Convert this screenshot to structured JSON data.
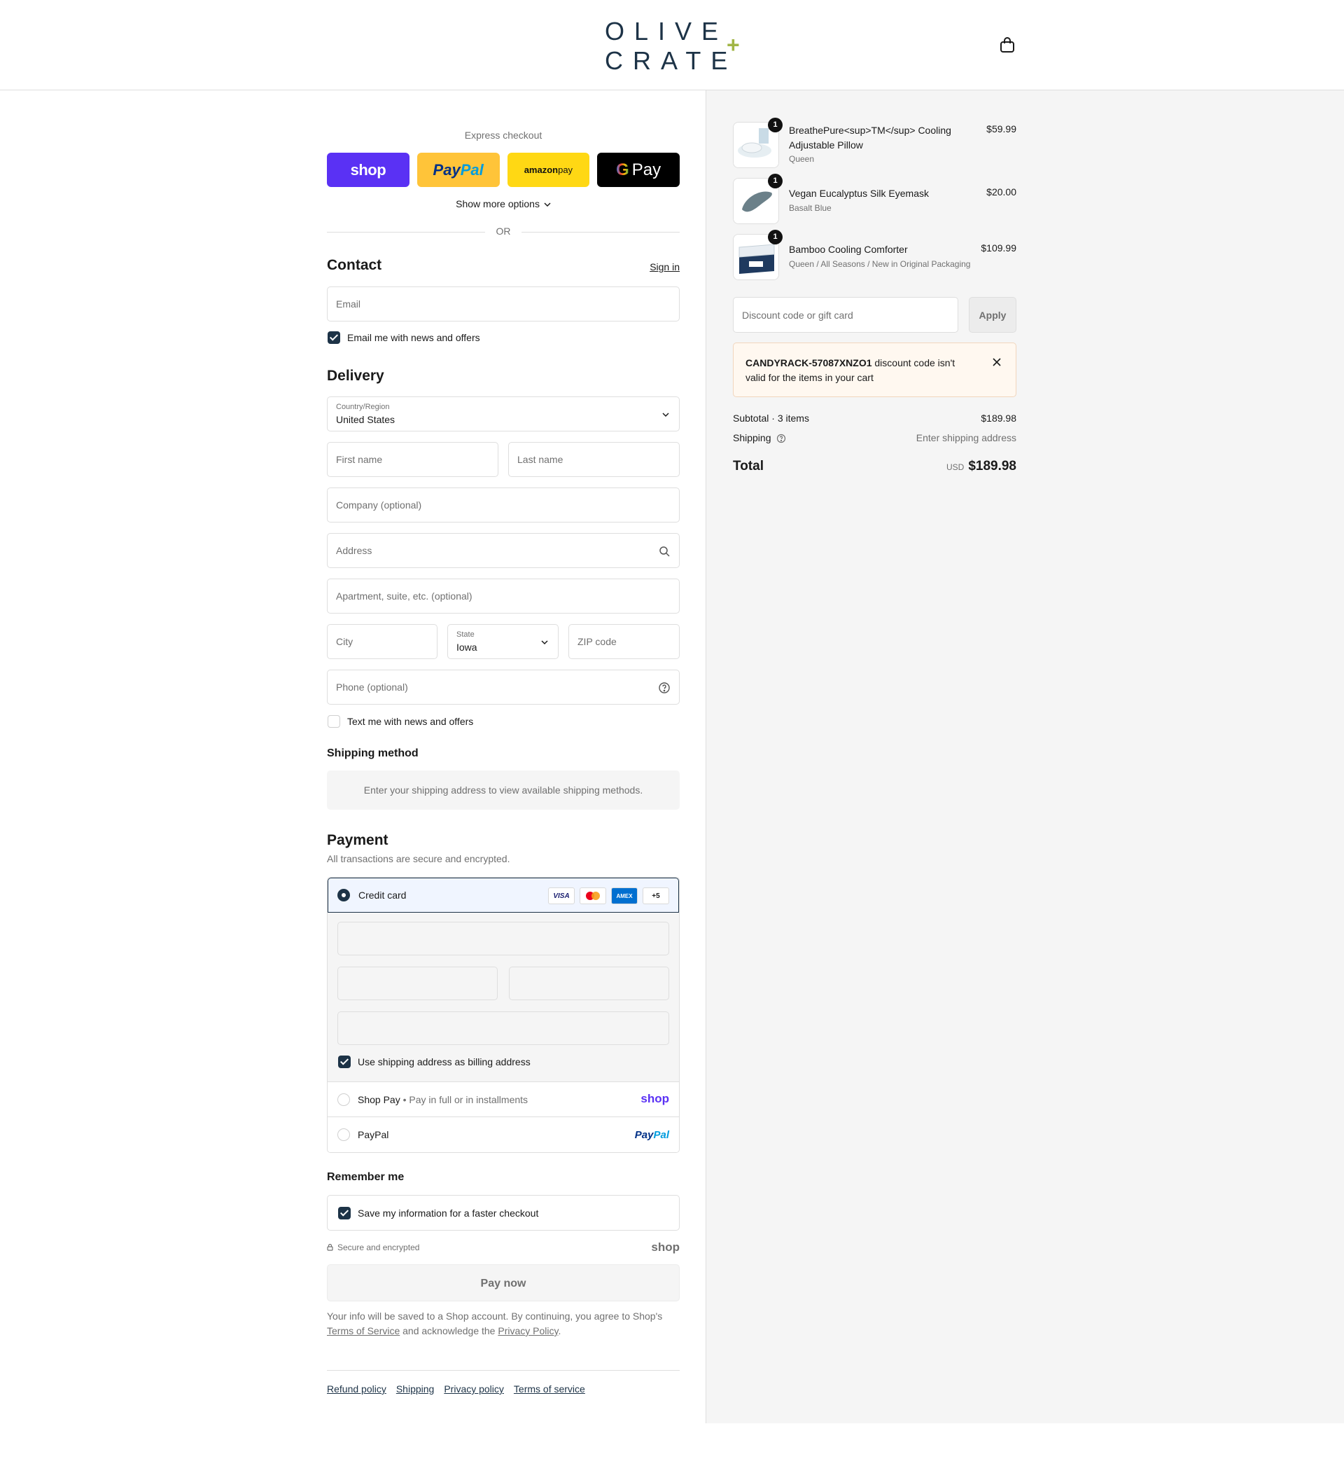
{
  "brand": {
    "line1": "OLIVE",
    "line2": "CRATE",
    "mark": "+",
    "accent": "#a1b545",
    "navy": "#1d3347"
  },
  "header": {
    "cart_icon": "shopping-bag-icon"
  },
  "express": {
    "title": "Express checkout",
    "shop_label": "shop",
    "paypal_label_a": "Pay",
    "paypal_label_b": "Pal",
    "amazon_label_a": "amazon",
    "amazon_label_b": " pay",
    "gpay_g": "G",
    "gpay_label": "Pay",
    "more_options": "Show more options",
    "or": "OR"
  },
  "contact": {
    "title": "Contact",
    "sign_in": "Sign in",
    "email_placeholder": "Email",
    "email_opt_in": "Email me with news and offers",
    "email_opt_in_checked": true
  },
  "delivery": {
    "title": "Delivery",
    "country_label": "Country/Region",
    "country_value": "United States",
    "first_name": "First name",
    "last_name": "Last name",
    "company": "Company (optional)",
    "address": "Address",
    "apartment": "Apartment, suite, etc. (optional)",
    "city": "City",
    "state_label": "State",
    "state_value": "Iowa",
    "zip": "ZIP code",
    "phone": "Phone (optional)",
    "text_opt_in": "Text me with news and offers",
    "text_opt_in_checked": false
  },
  "shipping_method": {
    "title": "Shipping method",
    "message": "Enter your shipping address to view available shipping methods."
  },
  "payment": {
    "title": "Payment",
    "subtitle": "All transactions are secure and encrypted.",
    "credit_card_label": "Credit card",
    "card_brands": {
      "visa": "VISA",
      "amex": "AMEX",
      "more": "+5"
    },
    "billing_same": "Use shipping address as billing address",
    "billing_same_checked": true,
    "shop_pay_label": "Shop Pay",
    "shop_pay_sep": "•",
    "shop_pay_desc": "Pay in full or in installments",
    "shop_pay_logo": "shop",
    "paypal_label": "PayPal",
    "paypal_logo_a": "Pay",
    "paypal_logo_b": "Pal"
  },
  "remember": {
    "title": "Remember me",
    "save_info": "Save my information for a faster checkout",
    "save_info_checked": true,
    "secure": "Secure and encrypted",
    "shop_logo": "shop"
  },
  "pay_now": "Pay now",
  "legal": {
    "text_a": "Your info will be saved to a Shop account. By continuing, you agree to Shop's",
    "terms": "Terms of Service",
    "text_b": "and acknowledge the",
    "privacy": "Privacy Policy",
    "text_c": "."
  },
  "footer": {
    "links": [
      "Refund policy",
      "Shipping",
      "Privacy policy",
      "Terms of service"
    ]
  },
  "cart": {
    "items": [
      {
        "name": "BreathePure<sup>TM</sup> Cooling Adjustable Pillow",
        "variant": "Queen",
        "price": "$59.99",
        "qty": "1"
      },
      {
        "name": "Vegan Eucalyptus Silk Eyemask",
        "variant": "Basalt Blue",
        "price": "$20.00",
        "qty": "1"
      },
      {
        "name": "Bamboo Cooling Comforter",
        "variant": "Queen / All Seasons / New in Original Packaging",
        "price": "$109.99",
        "qty": "1"
      }
    ],
    "discount_placeholder": "Discount code or gift card",
    "apply": "Apply",
    "error_code": "CANDYRACK-57087XNZO1",
    "error_msg": " discount code isn't valid for the items in your cart",
    "subtotal_label": "Subtotal · 3 items",
    "subtotal_value": "$189.98",
    "shipping_label": "Shipping",
    "shipping_value": "Enter shipping address",
    "total_label": "Total",
    "total_currency": "USD",
    "total_value": "$189.98"
  }
}
